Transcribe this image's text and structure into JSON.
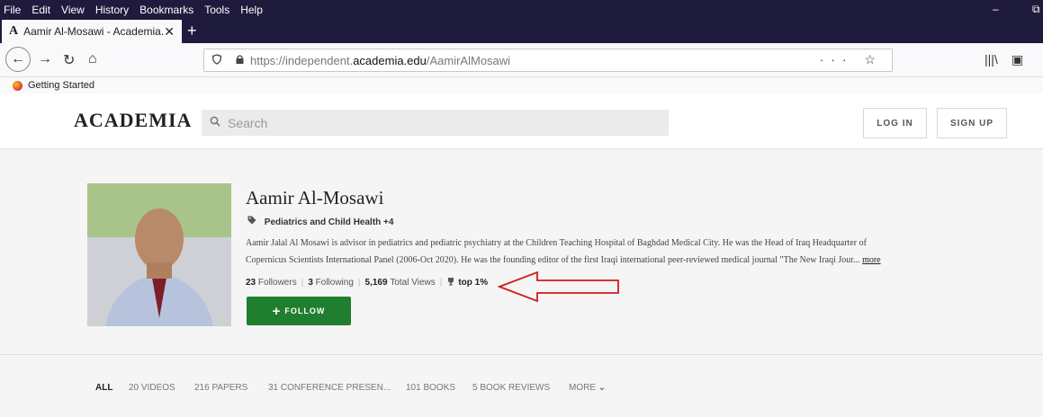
{
  "menu": [
    "File",
    "Edit",
    "View",
    "History",
    "Bookmarks",
    "Tools",
    "Help"
  ],
  "window_controls": {
    "minimize": "–",
    "restore": "⧉"
  },
  "tab": {
    "favicon": "A",
    "title": "Aamir Al-Mosawi - Academia.e",
    "close": "✕",
    "new_tab": "+"
  },
  "nav": {
    "back": "←",
    "forward": "→",
    "reload": "↻",
    "home": "⌂"
  },
  "url": {
    "prefix": "https://independent.",
    "domain": "academia.edu",
    "path": "/AamirAlMosawi",
    "actions": "··· ☆"
  },
  "toolbar_right": {
    "library": "|||\\",
    "sidebar": "▣"
  },
  "bookmarks": {
    "item": "Getting Started"
  },
  "site": {
    "logo": "ACADEMIA",
    "search_placeholder": "Search",
    "login": "LOG IN",
    "signup": "SIGN UP"
  },
  "profile": {
    "name": "Aamir Al-Mosawi",
    "tags": "Pediatrics and Child Health +4",
    "bio_line1": "Aamir Jalal Al Mosawi is advisor in pediatrics and pediatric psychiatry at the Children Teaching Hospital of Baghdad Medical City. He was the Head of Iraq Headquarter of",
    "bio_line2": "Copernicus Scientists International Panel (2006-Oct 2020). He was the founding editor of the first Iraqi international peer-reviewed medical journal \"The New Iraqi Jour...",
    "more": "more",
    "followers_count": "23",
    "followers_label": "Followers",
    "following_count": "3",
    "following_label": "Following",
    "views_count": "5,169",
    "views_label": "Total Views",
    "top_badge": "top 1%",
    "follow_button": "FOLLOW"
  },
  "profile_tabs": [
    {
      "label": "ALL",
      "active": true
    },
    {
      "label": "20 VIDEOS"
    },
    {
      "label": "216 PAPERS"
    },
    {
      "label": "31 CONFERENCE PRESEN..."
    },
    {
      "label": "101 BOOKS"
    },
    {
      "label": "5 BOOK REVIEWS"
    },
    {
      "label": "MORE"
    }
  ],
  "colors": {
    "follow_green": "#1f7f2f",
    "arrow_red": "#d11a1a",
    "menubar": "#1f1b3d"
  }
}
